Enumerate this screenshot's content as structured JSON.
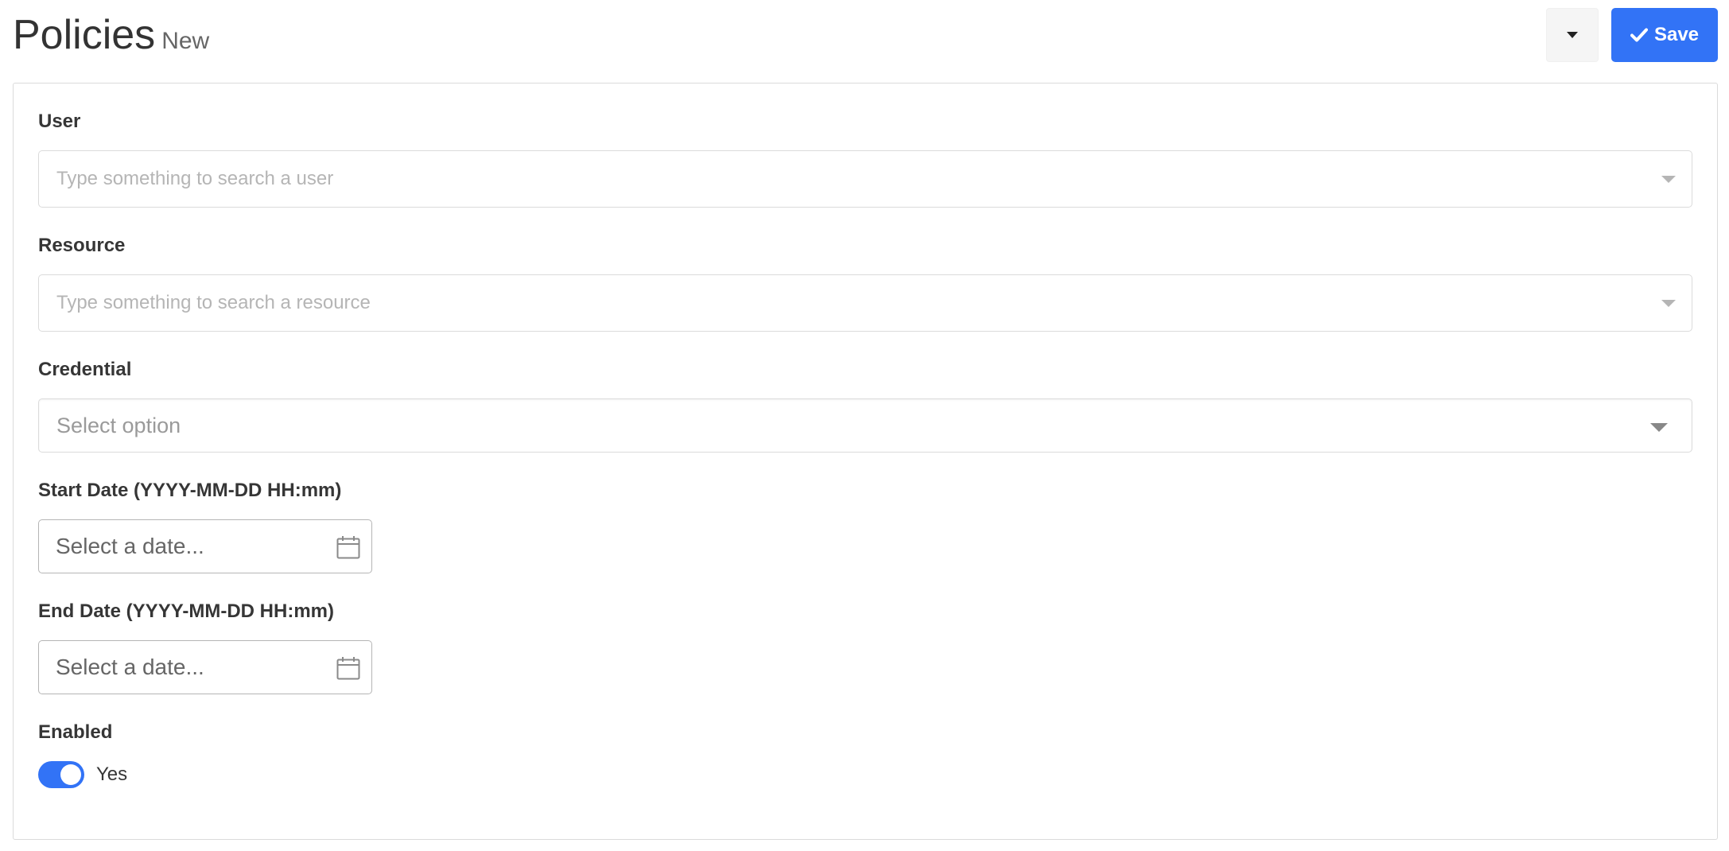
{
  "header": {
    "title": "Policies",
    "subtitle": "New",
    "more_icon": "caret-down-icon",
    "save_icon": "check-icon",
    "save_label": "Save"
  },
  "form": {
    "user": {
      "label": "User",
      "placeholder": "Type something to search a user"
    },
    "resource": {
      "label": "Resource",
      "placeholder": "Type something to search a resource"
    },
    "credential": {
      "label": "Credential",
      "placeholder": "Select option"
    },
    "start_date": {
      "label": "Start Date (YYYY-MM-DD HH:mm)",
      "placeholder": "Select a date...",
      "icon": "calendar-icon"
    },
    "end_date": {
      "label": "End Date (YYYY-MM-DD HH:mm)",
      "placeholder": "Select a date...",
      "icon": "calendar-icon"
    },
    "enabled": {
      "label": "Enabled",
      "value_label": "Yes",
      "checked": true
    }
  },
  "colors": {
    "primary": "#3273f6",
    "border": "#dbdbdb",
    "placeholder": "#b5b5b5"
  }
}
